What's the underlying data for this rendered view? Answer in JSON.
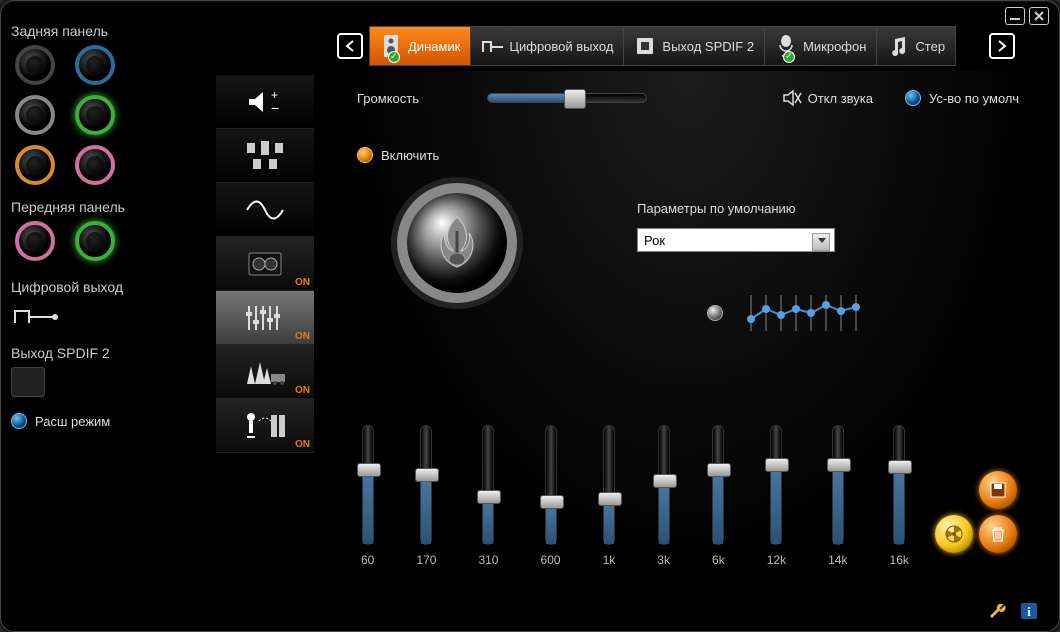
{
  "left_panel": {
    "back_title": "Задняя панель",
    "front_title": "Передняя панель",
    "digital_out": "Цифровой выход",
    "spdif2": "Выход SPDIF 2",
    "advanced_mode": "Расш режим"
  },
  "rail": {
    "on_label": "ON",
    "items": [
      {
        "id": "volume",
        "on": false
      },
      {
        "id": "speakers",
        "on": false
      },
      {
        "id": "sine",
        "on": false
      },
      {
        "id": "boombox",
        "on": true
      },
      {
        "id": "equalizer",
        "on": true,
        "active": true
      },
      {
        "id": "environment",
        "on": true
      },
      {
        "id": "karaoke",
        "on": true
      }
    ]
  },
  "tabs": {
    "items": [
      {
        "label": "Динамик",
        "active": true,
        "checked": true,
        "icon": "speaker"
      },
      {
        "label": "Цифровой выход",
        "active": false,
        "checked": false,
        "icon": "digital"
      },
      {
        "label": "Выход SPDIF 2",
        "active": false,
        "checked": false,
        "icon": "spdif"
      },
      {
        "label": "Микрофон",
        "active": false,
        "checked": true,
        "icon": "mic"
      },
      {
        "label": "Стер",
        "active": false,
        "checked": false,
        "icon": "music"
      }
    ]
  },
  "main": {
    "volume_label": "Громкость",
    "volume_percent": 55,
    "mute_label": "Откл звука",
    "default_device": "Ус-во по умолч",
    "enable_label": "Включить",
    "params_title": "Параметры по умолчанию",
    "preset_selected": "Рок",
    "eq_bands": [
      {
        "freq": "60",
        "value": 65
      },
      {
        "freq": "170",
        "value": 60
      },
      {
        "freq": "310",
        "value": 40
      },
      {
        "freq": "600",
        "value": 35
      },
      {
        "freq": "1k",
        "value": 38
      },
      {
        "freq": "3k",
        "value": 55
      },
      {
        "freq": "6k",
        "value": 65
      },
      {
        "freq": "12k",
        "value": 70
      },
      {
        "freq": "14k",
        "value": 70
      },
      {
        "freq": "16k",
        "value": 68
      }
    ]
  }
}
